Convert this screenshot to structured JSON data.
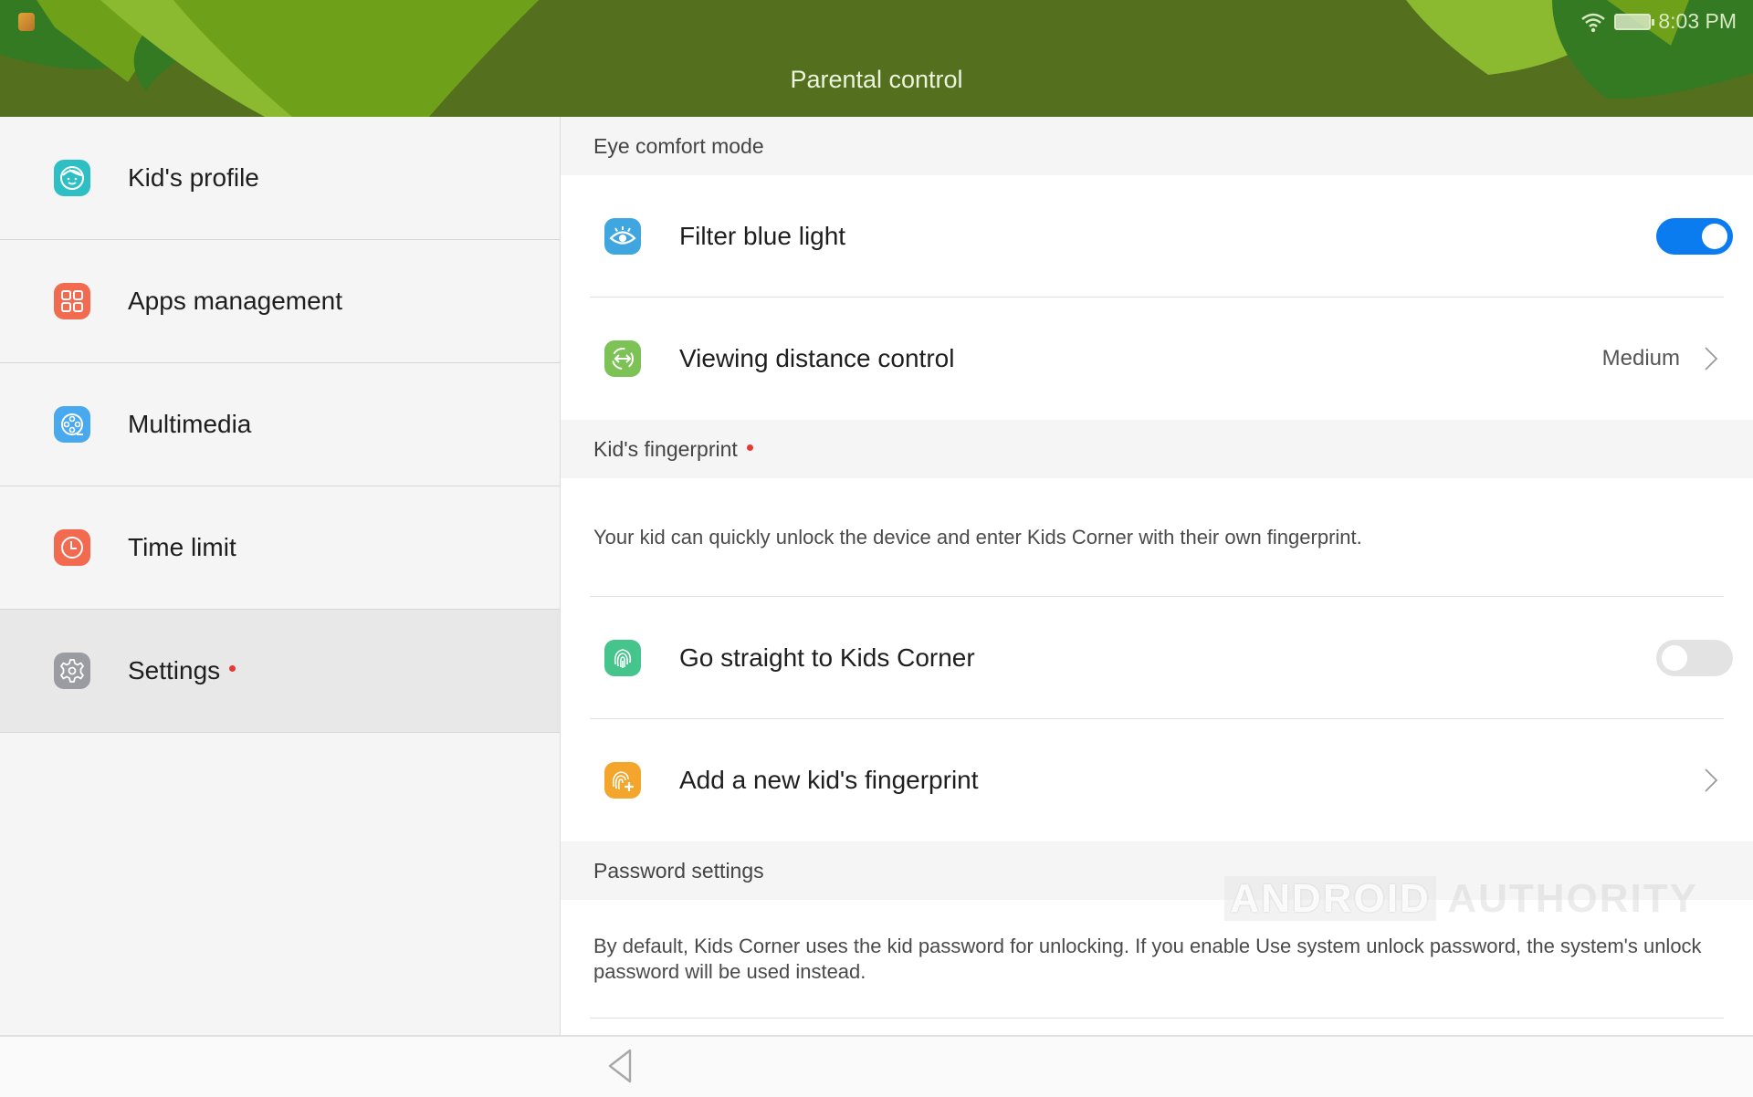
{
  "status_bar": {
    "time": "8:03 PM",
    "icons": [
      "app-notification-icon",
      "wifi-icon",
      "battery-icon"
    ]
  },
  "header": {
    "title": "Parental control",
    "colors": {
      "background": "#546f1e",
      "leaf_light": "#8bb92f",
      "leaf_mid": "#6fa01a",
      "leaf_dark": "#337a22"
    }
  },
  "sidebar": {
    "items": [
      {
        "label": "Kid's profile",
        "icon": "kid-face-icon",
        "color": "#2dbfc4",
        "active": false,
        "badge": false
      },
      {
        "label": "Apps management",
        "icon": "apps-grid-icon",
        "color": "#f26a4f",
        "active": false,
        "badge": false
      },
      {
        "label": "Multimedia",
        "icon": "film-reel-icon",
        "color": "#49a9ee",
        "active": false,
        "badge": false
      },
      {
        "label": "Time limit",
        "icon": "clock-icon",
        "color": "#f26a4f",
        "active": false,
        "badge": false
      },
      {
        "label": "Settings",
        "icon": "gear-icon",
        "color": "#9a9ca1",
        "active": true,
        "badge": true
      }
    ]
  },
  "main": {
    "eye_comfort": {
      "header": "Eye comfort mode",
      "filter_blue_light": {
        "label": "Filter blue light",
        "icon": "eye-icon",
        "color": "#3fa6e0",
        "enabled": true
      },
      "viewing_distance": {
        "label": "Viewing distance control",
        "icon": "distance-arrows-icon",
        "color": "#7cc254",
        "value": "Medium"
      }
    },
    "fingerprint": {
      "header": "Kid's fingerprint",
      "badge": true,
      "description": "Your kid can quickly unlock the device and enter Kids Corner with their own fingerprint.",
      "go_straight": {
        "label": "Go straight to Kids Corner",
        "icon": "fingerprint-icon",
        "color": "#45c48c",
        "enabled": false
      },
      "add_fingerprint": {
        "label": "Add a new kid's fingerprint",
        "icon": "fingerprint-add-icon",
        "color": "#f3a62b"
      }
    },
    "password": {
      "header": "Password settings",
      "description": "By default, Kids Corner uses the kid password for unlocking. If you enable Use system unlock password, the system's unlock password will be used instead."
    },
    "toggle_on_color": "#0a7cf0"
  },
  "watermark": {
    "part1": "ANDROID",
    "part2": "AUTHORITY"
  },
  "navbar": {
    "back": "back-icon"
  }
}
